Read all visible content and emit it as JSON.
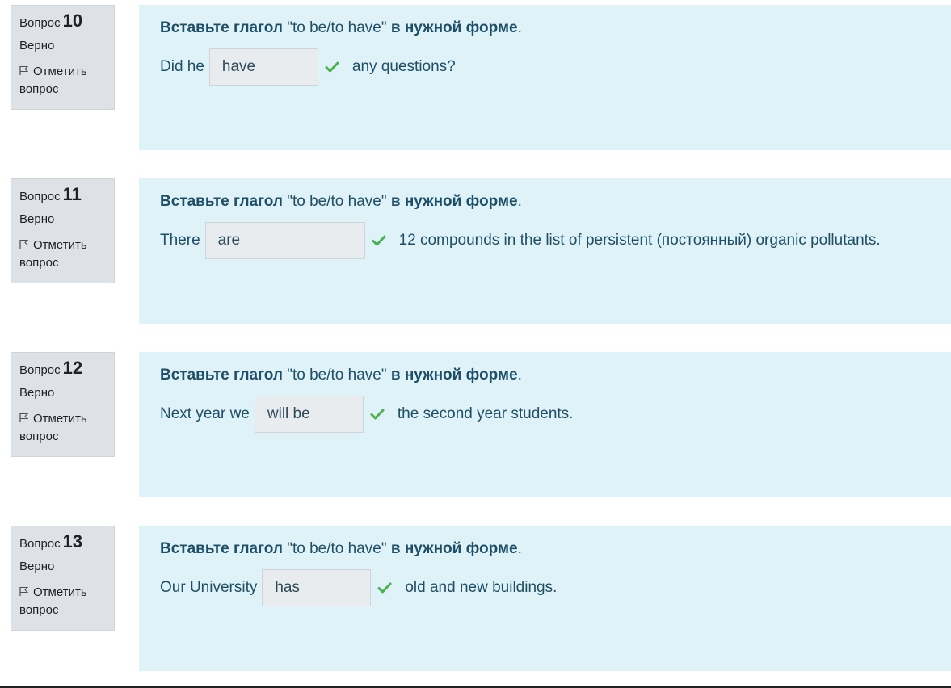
{
  "questions": [
    {
      "label": "Вопрос",
      "number": "10",
      "state": "Верно",
      "flag_label": "Отметить вопрос",
      "prompt_bold_1": "Вставьте глагол ",
      "prompt_normal": "\"to be/to have\"",
      "prompt_bold_2": " в нужной форме",
      "prompt_end": ".",
      "before": "Did he",
      "answer": "have",
      "after": "any questions?"
    },
    {
      "label": "Вопрос",
      "number": "11",
      "state": "Верно",
      "flag_label": "Отметить вопрос",
      "prompt_bold_1": "Вставьте глагол ",
      "prompt_normal": "\"to be/to have\"",
      "prompt_bold_2": " в нужной форме",
      "prompt_end": ".",
      "before": "There",
      "answer": "are",
      "after": "12 compounds in the list of persistent (постоянный) organic pollutants."
    },
    {
      "label": "Вопрос",
      "number": "12",
      "state": "Верно",
      "flag_label": "Отметить вопрос",
      "prompt_bold_1": "Вставьте глагол ",
      "prompt_normal": "\"to be/to have\"",
      "prompt_bold_2": " в нужной форме",
      "prompt_end": ".",
      "before": "Next year we",
      "answer": "will be",
      "after": "the second year students."
    },
    {
      "label": "Вопрос",
      "number": "13",
      "state": "Верно",
      "flag_label": "Отметить вопрос",
      "prompt_bold_1": "Вставьте глагол ",
      "prompt_normal": "\"to be/to have\"",
      "prompt_bold_2": " в нужной форме",
      "prompt_end": ".",
      "before": "Our University",
      "answer": "has",
      "after": "old and new buildings."
    }
  ],
  "icons": {
    "flag": "flag-icon",
    "correct": "check-icon"
  },
  "colors": {
    "info_bg": "#dee2e6",
    "content_bg": "#def2f8",
    "text": "#1e4f66",
    "correct": "#4caf50"
  }
}
